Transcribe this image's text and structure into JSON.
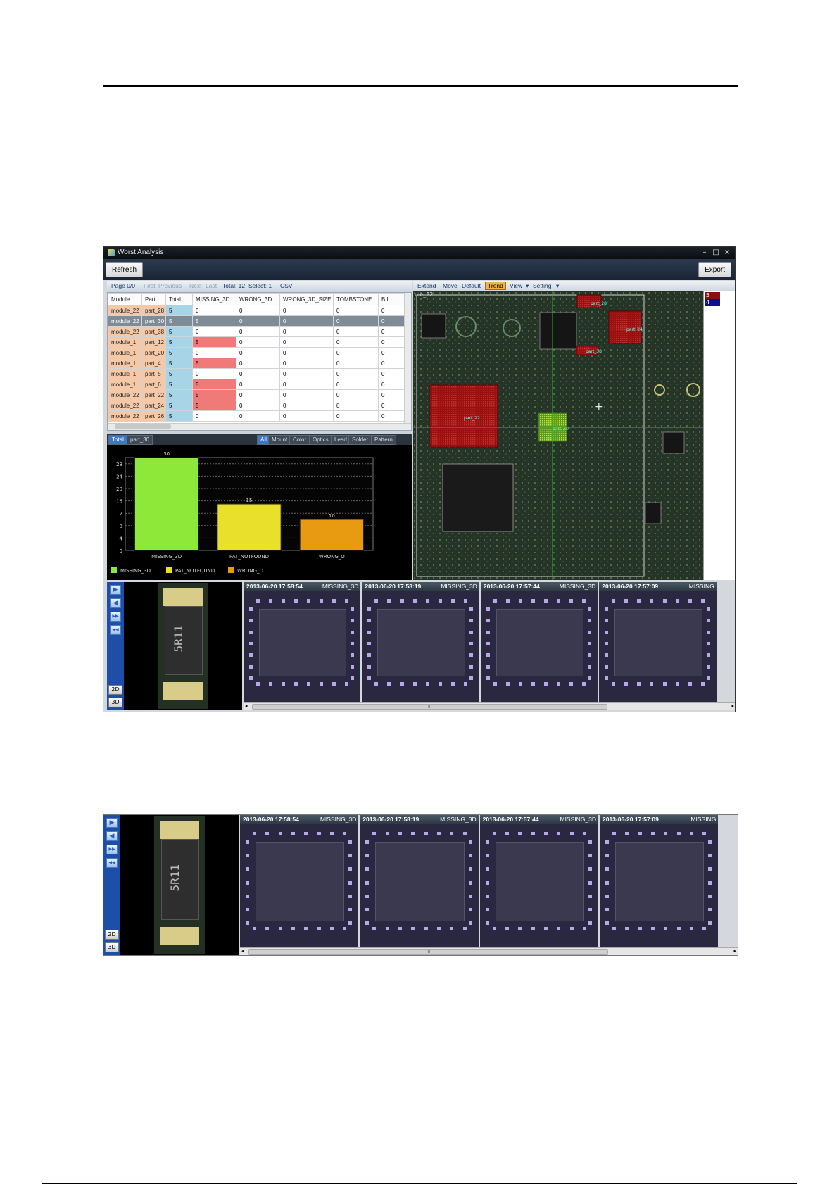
{
  "window": {
    "title": "Worst Analysis",
    "refresh_label": "Refresh",
    "export_label": "Export",
    "min_glyph": "–",
    "max_glyph": "□",
    "close_glyph": "×"
  },
  "pager": {
    "page": "Page  0/0",
    "first": "First",
    "previous": "Previous",
    "next": "Next",
    "last": "Last",
    "total": "Total:  12",
    "select": "Select:  1",
    "csv": "CSV"
  },
  "table": {
    "columns": [
      "Module",
      "Part",
      "Total",
      "MISSING_3D",
      "WRONG_3D",
      "WRONG_3D_SIZE",
      "TOMBSTONE",
      "BIL"
    ],
    "rows": [
      {
        "module": "module_22",
        "part": "part_28",
        "total": "5",
        "c": [
          "0",
          "0",
          "0",
          "0",
          "0"
        ],
        "red": false
      },
      {
        "module": "module_22",
        "part": "part_30",
        "total": "5",
        "c": [
          "5",
          "0",
          "0",
          "0",
          "0"
        ],
        "red": false,
        "selected": true
      },
      {
        "module": "module_22",
        "part": "part_38",
        "total": "5",
        "c": [
          "0",
          "0",
          "0",
          "0",
          "0"
        ],
        "red": false
      },
      {
        "module": "module_1",
        "part": "part_12",
        "total": "5",
        "c": [
          "5",
          "0",
          "0",
          "0",
          "0"
        ],
        "red": true
      },
      {
        "module": "module_1",
        "part": "part_20",
        "total": "5",
        "c": [
          "0",
          "0",
          "0",
          "0",
          "0"
        ],
        "red": false
      },
      {
        "module": "module_1",
        "part": "part_4",
        "total": "5",
        "c": [
          "5",
          "0",
          "0",
          "0",
          "0"
        ],
        "red": true
      },
      {
        "module": "module_1",
        "part": "part_5",
        "total": "5",
        "c": [
          "0",
          "0",
          "0",
          "0",
          "0"
        ],
        "red": false
      },
      {
        "module": "module_1",
        "part": "part_6",
        "total": "5",
        "c": [
          "5",
          "0",
          "0",
          "0",
          "0"
        ],
        "red": true
      },
      {
        "module": "module_22",
        "part": "part_22",
        "total": "5",
        "c": [
          "5",
          "0",
          "0",
          "0",
          "0"
        ],
        "red": true
      },
      {
        "module": "module_22",
        "part": "part_24",
        "total": "5",
        "c": [
          "5",
          "0",
          "0",
          "0",
          "0"
        ],
        "red": true
      },
      {
        "module": "module_22",
        "part": "part_26",
        "total": "5",
        "c": [
          "0",
          "0",
          "0",
          "0",
          "0"
        ],
        "red": false
      }
    ]
  },
  "chart_tabs": {
    "left": [
      "Total",
      "part_30"
    ],
    "right": [
      "All",
      "Mount",
      "Color",
      "Optics",
      "Lead",
      "Solder",
      "Pattern"
    ]
  },
  "chart_data": {
    "type": "bar",
    "title": "",
    "xlabel": "",
    "ylabel": "",
    "categories": [
      "MISSING_3D",
      "PAT_NOTFOUND",
      "WRONG_O"
    ],
    "values": [
      30,
      15,
      10
    ],
    "colors": [
      "#8ee83a",
      "#e8e02a",
      "#e89a10"
    ],
    "ylim": [
      0,
      30
    ],
    "yticks": [
      0,
      4,
      8,
      12,
      16,
      20,
      24,
      28
    ],
    "grid": true,
    "legend": [
      "MISSING_3D",
      "PAT_NOTFOUND",
      "WRONG_O"
    ]
  },
  "map_toolbar": {
    "extend": "Extend",
    "move": "Move",
    "default": "Default",
    "trend": "Trend",
    "view": "View",
    "setting": "Setting",
    "module_label": "ule_22"
  },
  "map_labels": {
    "part_28": "part_28",
    "part_24": "part_24",
    "part_38": "part_38",
    "part_22": "part_22",
    "part_30": "part_30"
  },
  "map_legend": [
    {
      "label": "5",
      "color": "#8a1010"
    },
    {
      "label": "4",
      "color": "#10108a"
    }
  ],
  "viewer": {
    "part_marking": "5R11",
    "btn_2d": "2D",
    "btn_3d": "3D",
    "thumbs": [
      {
        "time": "2013-06-20 17:58:54",
        "type": "MISSING_3D"
      },
      {
        "time": "2013-06-20 17:58:19",
        "type": "MISSING_3D"
      },
      {
        "time": "2013-06-20 17:57:44",
        "type": "MISSING_3D"
      },
      {
        "time": "2013-06-20 17:57:09",
        "type": "MISSING"
      }
    ],
    "scroll_mark": "III"
  }
}
